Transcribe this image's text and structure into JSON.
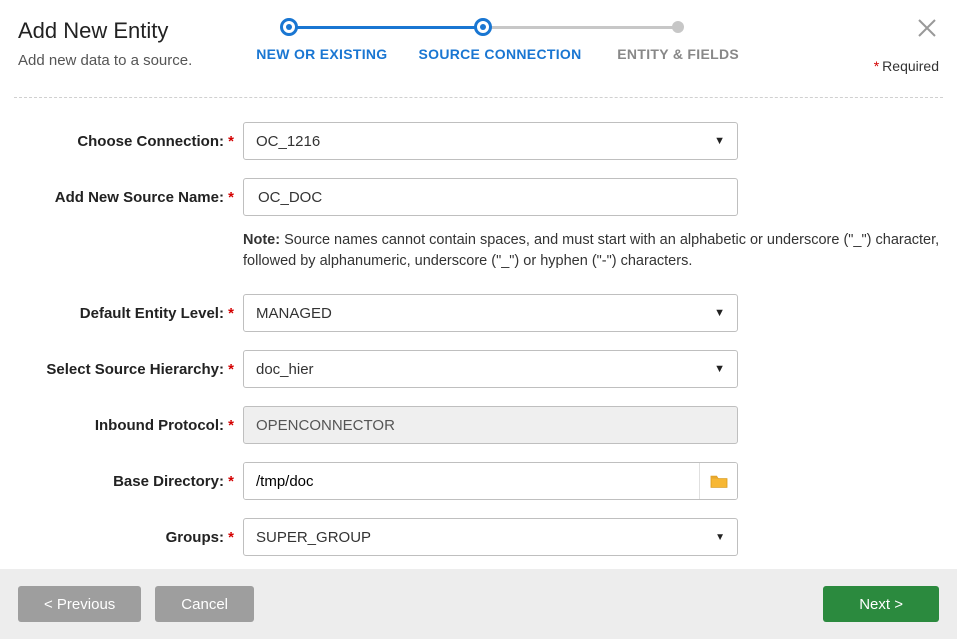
{
  "header": {
    "title": "Add New Entity",
    "subtitle": "Add new data to a source.",
    "required_label": "Required"
  },
  "stepper": {
    "step1": "NEW OR EXISTING",
    "step2": "SOURCE CONNECTION",
    "step3": "ENTITY & FIELDS"
  },
  "form": {
    "connection": {
      "label": "Choose Connection:",
      "value": "OC_1216"
    },
    "source_name": {
      "label": "Add New Source Name:",
      "value": "OC_DOC"
    },
    "note_prefix": "Note:",
    "note_body": " Source names cannot contain spaces, and must start with an alphabetic or underscore (\"_\") character, followed by alphanumeric, underscore (\"_\") or hyphen (\"-\") characters.",
    "entity_level": {
      "label": "Default Entity Level:",
      "value": "MANAGED"
    },
    "hierarchy": {
      "label": "Select Source Hierarchy:",
      "value": "doc_hier"
    },
    "protocol": {
      "label": "Inbound Protocol:",
      "value": "OPENCONNECTOR"
    },
    "base_dir": {
      "label": "Base Directory:",
      "value": "/tmp/doc"
    },
    "groups": {
      "label": "Groups:",
      "value": "SUPER_GROUP"
    }
  },
  "footer": {
    "previous": "< Previous",
    "cancel": "Cancel",
    "next": "Next >"
  }
}
